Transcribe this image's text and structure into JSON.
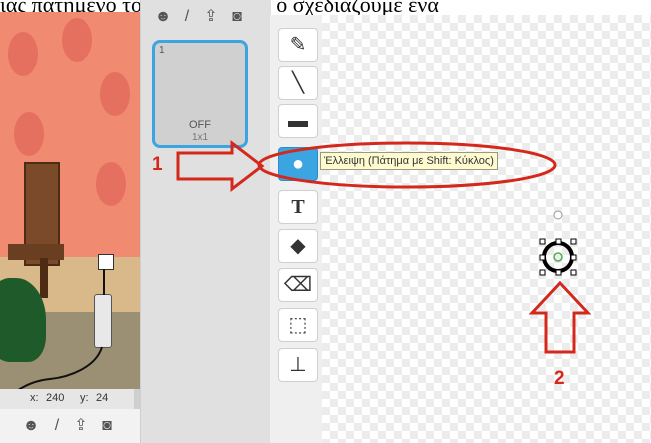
{
  "caption": "ιας πατημένο το πλήκτρο Shift ό σχεδιάζουμε ένα",
  "stage": {
    "coord_x_label": "x:",
    "coord_x_value": "240",
    "coord_y_label": "y:",
    "coord_y_value": "24",
    "plug_text": "■"
  },
  "costume": {
    "number": "1",
    "name": "OFF",
    "size": "1x1"
  },
  "toolbar": {
    "tools": [
      {
        "name": "brush",
        "glyph": "✎"
      },
      {
        "name": "line",
        "glyph": "╲"
      },
      {
        "name": "rectangle",
        "glyph": "▬"
      },
      {
        "name": "ellipse",
        "glyph": "●"
      },
      {
        "name": "text",
        "glyph": "T"
      },
      {
        "name": "fill",
        "glyph": "◆"
      },
      {
        "name": "eraser",
        "glyph": "⌫"
      },
      {
        "name": "select",
        "glyph": "⬚"
      },
      {
        "name": "stamp",
        "glyph": "⊥"
      }
    ],
    "active_tool": "ellipse"
  },
  "tooltip": "Έλλειψη (Πάτημα με Shift: Κύκλος)",
  "annotations": {
    "label_1": "1",
    "label_2": "2",
    "color": "#d4281c"
  },
  "colors": {
    "accent": "#3aa5e0",
    "stage_wall": "#f08a70"
  }
}
